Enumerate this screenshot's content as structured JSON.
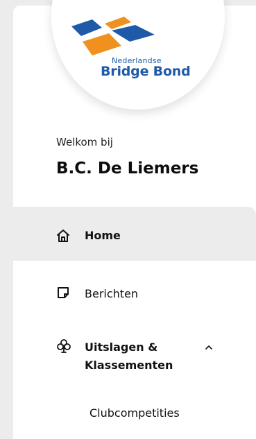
{
  "logo": {
    "sub": "Nederlandse",
    "main": "Bridge Bond",
    "colors": {
      "blue": "#1e5aa8",
      "orange": "#f0901f",
      "text": "#1e5aa8"
    }
  },
  "welcome": {
    "greeting": "Welkom bij",
    "club_name": "B.C. De Liemers"
  },
  "nav": {
    "home": {
      "label": "Home",
      "icon": "home-icon",
      "active": true
    },
    "berichten": {
      "label": "Berichten",
      "icon": "note-icon"
    },
    "uitslagen": {
      "label": "Uitslagen & Klassementen",
      "icon": "club-suit-icon",
      "expanded": true,
      "subitems": [
        "Clubcompetities"
      ]
    }
  },
  "colors": {
    "page_bg": "#ececec",
    "panel_bg": "#ffffff",
    "active_bg": "#ececec"
  }
}
